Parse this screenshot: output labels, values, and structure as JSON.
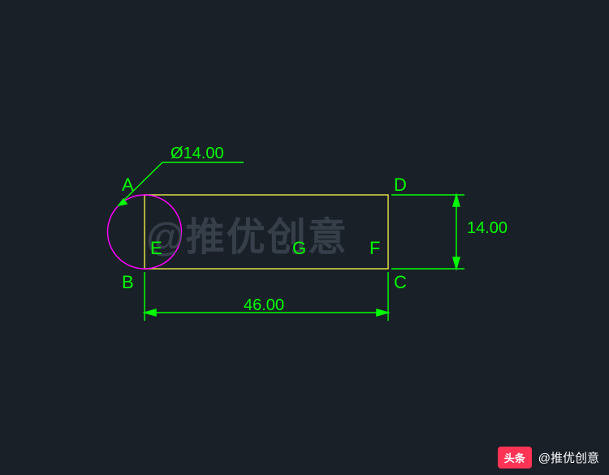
{
  "points": {
    "A": "A",
    "B": "B",
    "C": "C",
    "D": "D",
    "E": "E",
    "F": "F",
    "G": "G"
  },
  "dimensions": {
    "width": "46.00",
    "height": "14.00",
    "diameter": "Ø14.00"
  },
  "geometry": {
    "rect_width_value": 46.0,
    "rect_height_value": 14.0,
    "circle_diameter_value": 14.0
  },
  "watermark": "@推优创意",
  "footer": {
    "badge": "头条",
    "handle": "@推优创意"
  },
  "colors": {
    "bg": "#1a2028",
    "green": "#00ff00",
    "magenta": "#ff00ff",
    "yellow": "#dddd44",
    "watermark": "#4a5560"
  }
}
